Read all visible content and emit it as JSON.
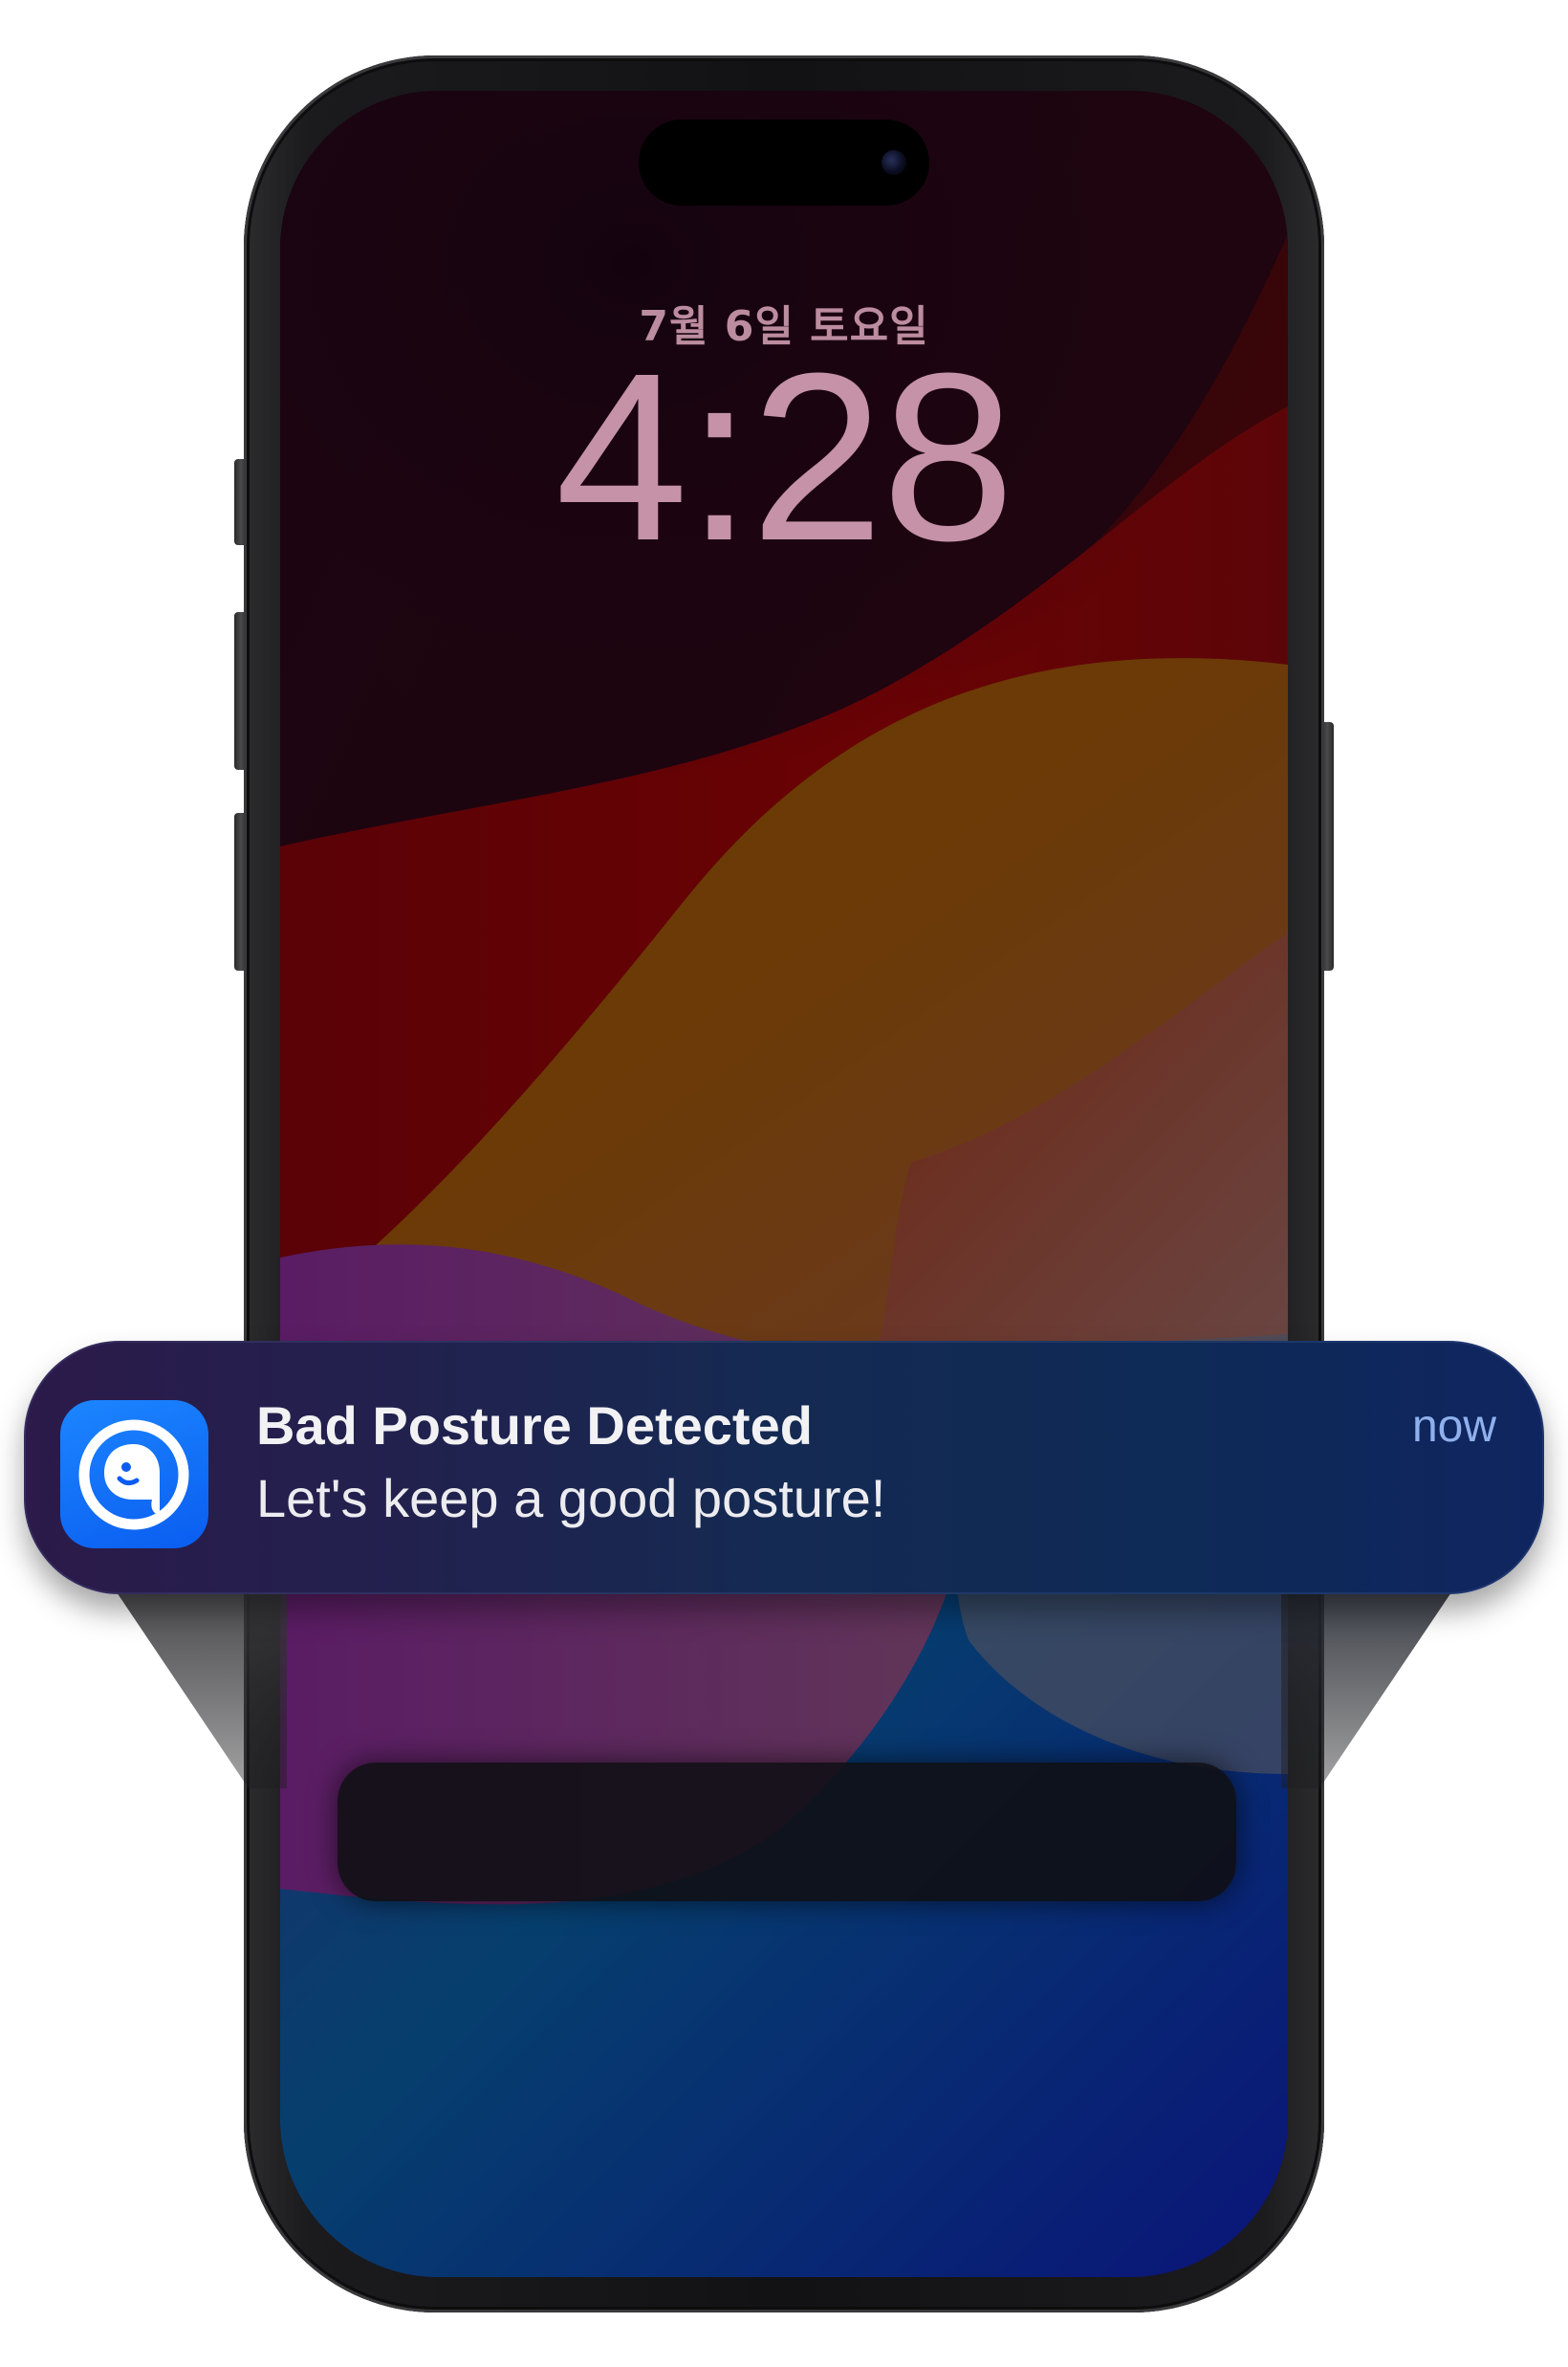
{
  "lock_screen": {
    "date": "7월 6일 토요일",
    "time": "4:28"
  },
  "notification": {
    "app_icon": "posture-app-icon",
    "title": "Bad Posture Detected",
    "body": "Let's keep a good posture!",
    "time": "now"
  },
  "colors": {
    "notification_accent": "#0a5df0",
    "time_text": "#e4acc2"
  }
}
